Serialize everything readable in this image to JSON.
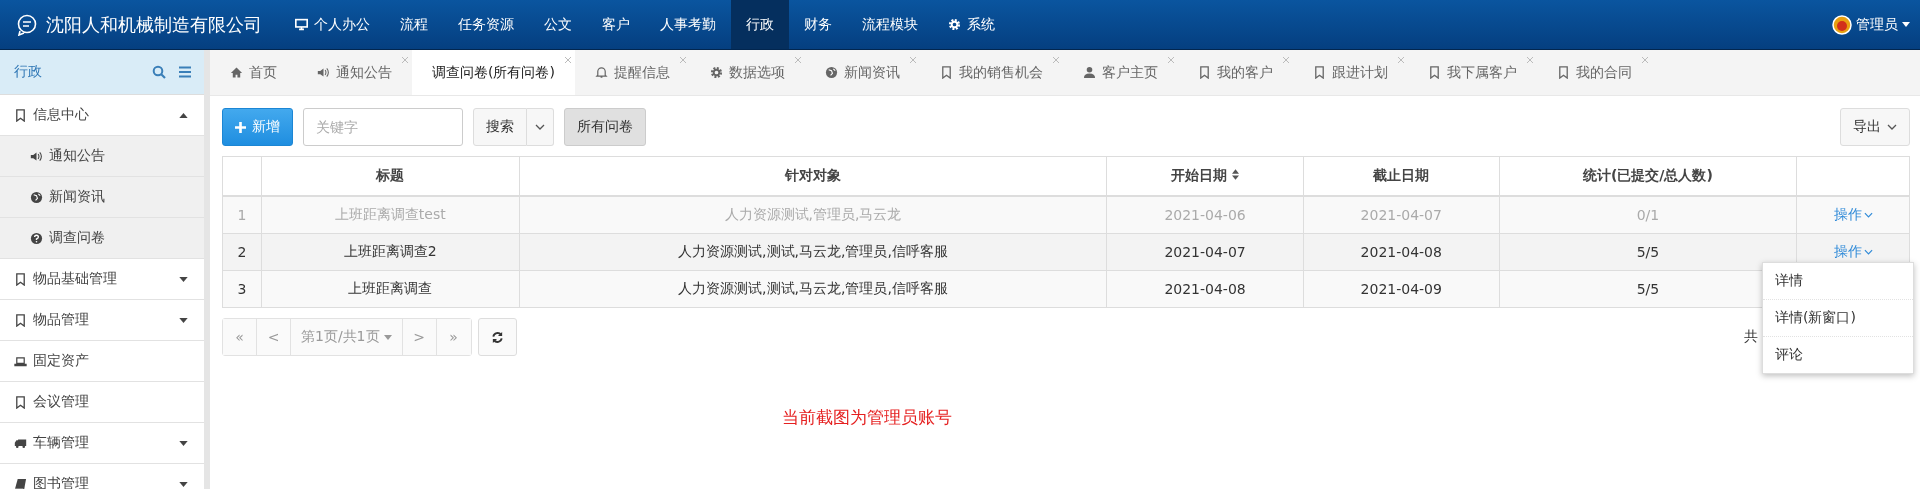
{
  "app": {
    "title": "沈阳人和机械制造有限公司",
    "user": "管理员"
  },
  "nav": [
    {
      "label": "个人办公",
      "selected": false
    },
    {
      "label": "流程",
      "selected": false
    },
    {
      "label": "任务资源",
      "selected": false
    },
    {
      "label": "公文",
      "selected": false
    },
    {
      "label": "客户",
      "selected": false
    },
    {
      "label": "人事考勤",
      "selected": false
    },
    {
      "label": "行政",
      "selected": true
    },
    {
      "label": "财务",
      "selected": false
    },
    {
      "label": "流程模块",
      "selected": false
    },
    {
      "label": "系统",
      "selected": false
    }
  ],
  "sidebar": {
    "title": "行政",
    "items": [
      {
        "label": "信息中心",
        "kind": "group",
        "expanded": true,
        "children": [
          {
            "label": "通知公告"
          },
          {
            "label": "新闻资讯"
          },
          {
            "label": "调查问卷"
          }
        ]
      },
      {
        "label": "物品基础管理",
        "kind": "group",
        "expanded": false
      },
      {
        "label": "物品管理",
        "kind": "group",
        "expanded": false
      },
      {
        "label": "固定资产",
        "kind": "link"
      },
      {
        "label": "会议管理",
        "kind": "link"
      },
      {
        "label": "车辆管理",
        "kind": "group",
        "expanded": false
      },
      {
        "label": "图书管理",
        "kind": "group",
        "expanded": false
      }
    ]
  },
  "tabs": [
    {
      "label": "首页",
      "selected": false,
      "closable": false
    },
    {
      "label": "通知公告",
      "selected": false,
      "closable": true
    },
    {
      "label": "调查问卷(所有问卷)",
      "selected": true,
      "closable": true
    },
    {
      "label": "提醒信息",
      "selected": false,
      "closable": true
    },
    {
      "label": "数据选项",
      "selected": false,
      "closable": true
    },
    {
      "label": "新闻资讯",
      "selected": false,
      "closable": true
    },
    {
      "label": "我的销售机会",
      "selected": false,
      "closable": true
    },
    {
      "label": "客户主页",
      "selected": false,
      "closable": true
    },
    {
      "label": "我的客户",
      "selected": false,
      "closable": true
    },
    {
      "label": "跟进计划",
      "selected": false,
      "closable": true
    },
    {
      "label": "我下属客户",
      "selected": false,
      "closable": true
    },
    {
      "label": "我的合同",
      "selected": false,
      "closable": true
    }
  ],
  "toolbar": {
    "add": "新增",
    "search": {
      "placeholder": "关键字"
    },
    "search_button": "搜索",
    "filter": "所有问卷",
    "export": "导出"
  },
  "table": {
    "columns": [
      "标题",
      "针对对象",
      "开始日期",
      "截止日期",
      "统计(已提交/总人数)"
    ],
    "rows": [
      {
        "index": "1",
        "title": "上班距离调查test",
        "target": "人力资源测试,管理员,马云龙",
        "start": "2021-04-06",
        "end": "2021-04-07",
        "stats": "0/1",
        "action": "操作",
        "expired": true
      },
      {
        "index": "2",
        "title": "上班距离调查2",
        "target": "人力资源测试,测试,马云龙,管理员,信呼客服",
        "start": "2021-04-07",
        "end": "2021-04-08",
        "stats": "5/5",
        "action": "操作",
        "expired": false
      },
      {
        "index": "3",
        "title": "上班距离调查",
        "target": "人力资源测试,测试,马云龙,管理员,信呼客服",
        "start": "2021-04-08",
        "end": "2021-04-09",
        "stats": "5/5",
        "expired": false
      }
    ]
  },
  "pagination": {
    "first": "«",
    "prev": "<",
    "page": "第1页/共1页",
    "next": ">",
    "last": "»",
    "total": "共"
  },
  "menu": [
    "详情",
    "详情(新窗口)",
    "评论"
  ],
  "note": "当前截图为管理员账号"
}
